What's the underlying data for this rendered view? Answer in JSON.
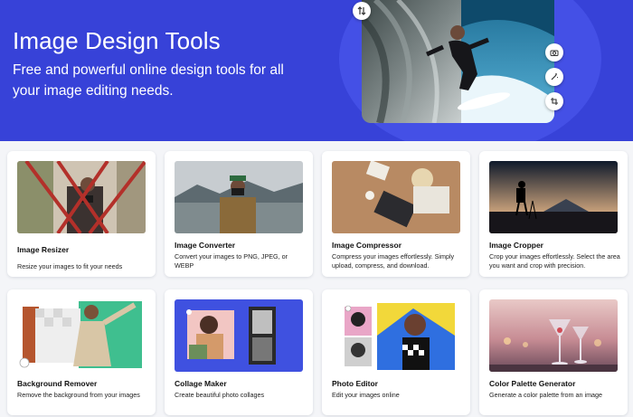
{
  "hero": {
    "title": "Image Design Tools",
    "subtitle": "Free and powerful online design tools for all your image editing needs.",
    "icons": [
      "sort-swap-icon",
      "camera-icon",
      "magic-wand-icon",
      "crop-icon"
    ]
  },
  "colors": {
    "hero_bg": "#3742d8",
    "card_bg": "#ffffff",
    "page_bg": "#f4f5f8"
  },
  "tools": [
    {
      "title": "Image Resizer",
      "description": "Resize your images to fit your needs"
    },
    {
      "title": "Image Converter",
      "description": "Convert your images to PNG, JPEG, or WEBP"
    },
    {
      "title": "Image Compressor",
      "description": "Compress your images effortlessly. Simply upload, compress, and download."
    },
    {
      "title": "Image Cropper",
      "description": "Crop your images effortlessly. Select the area you want and crop with precision."
    },
    {
      "title": "Background Remover",
      "description": "Remove the background from your images"
    },
    {
      "title": "Collage Maker",
      "description": "Create beautiful photo collages"
    },
    {
      "title": "Photo Editor",
      "description": "Edit your images online"
    },
    {
      "title": "Color Palette Generator",
      "description": "Generate a color palette from an image"
    }
  ]
}
